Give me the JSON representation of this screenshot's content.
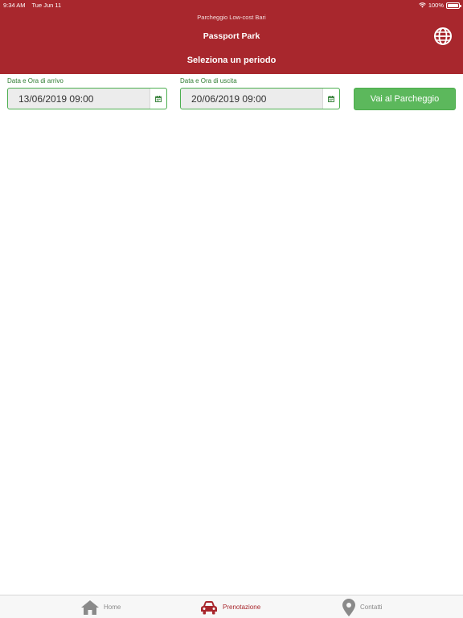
{
  "status_bar": {
    "time": "9:34 AM",
    "date": "Tue Jun 11",
    "battery": "100%"
  },
  "header": {
    "subtitle": "Parcheggio Low-cost Bari",
    "title": "Passport Park",
    "language_icon": "globe-icon",
    "section_title": "Seleziona un periodo",
    "color": "#a8272d"
  },
  "form": {
    "arrival_label": "Data e Ora di arrivo",
    "arrival_value": "13/06/2019 09:00",
    "departure_label": "Data e Ora di uscita",
    "departure_value": "20/06/2019 09:00",
    "calendar_icon": "calendar-icon",
    "submit_label": "Vai al Parcheggio",
    "accent": "#5cb85c"
  },
  "tabbar": {
    "items": [
      {
        "label": "Home",
        "icon": "home-icon",
        "active": false
      },
      {
        "label": "Prenotazione",
        "icon": "car-icon",
        "active": true
      },
      {
        "label": "Contatti",
        "icon": "map-pin-icon",
        "active": false
      }
    ]
  }
}
